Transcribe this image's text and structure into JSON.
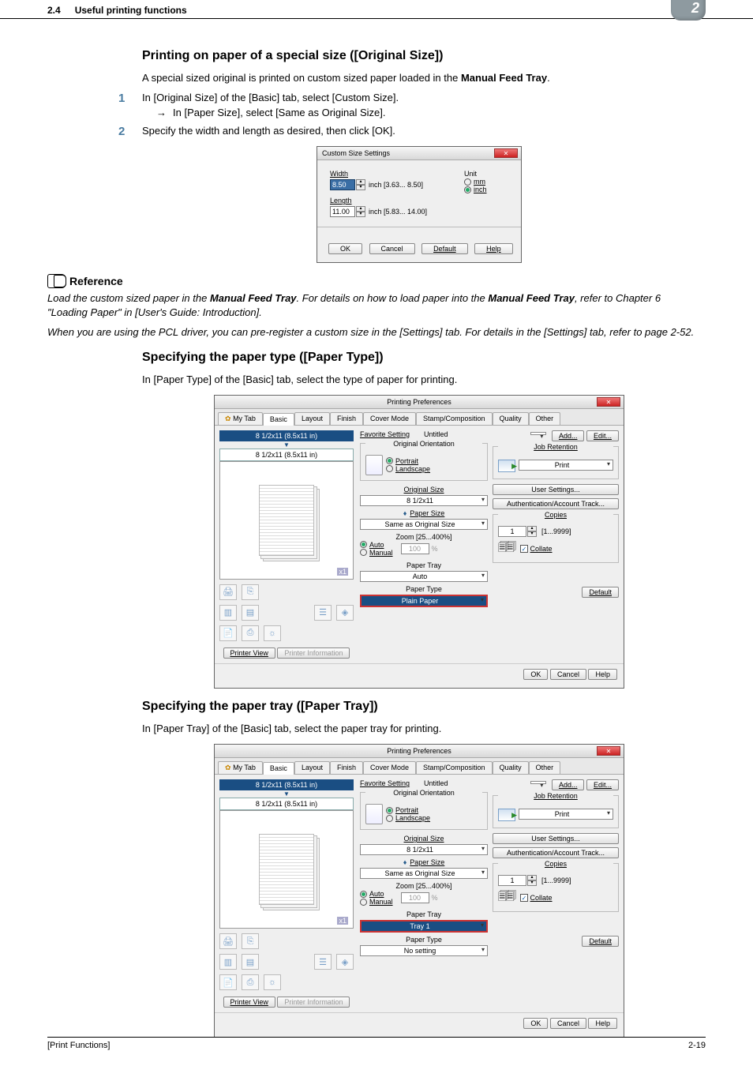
{
  "header": {
    "section_num": "2.4",
    "section_title": "Useful printing functions",
    "chapter": "2"
  },
  "section1": {
    "title": "Printing on paper of a special size ([Original Size])",
    "intro_a": "A special sized original is printed on custom sized paper loaded in the ",
    "intro_b": "Manual Feed Tray",
    "intro_c": ".",
    "step1": "In [Original Size] of the [Basic] tab, select [Custom Size].",
    "step1_sub": "In [Paper Size], select [Same as Original Size].",
    "step2": "Specify the width and length as desired, then click [OK]."
  },
  "custom_dialog": {
    "title": "Custom Size Settings",
    "width_label": "Width",
    "width_value": "8.50",
    "width_range": "inch [3.63... 8.50]",
    "length_label": "Length",
    "length_value": "11.00",
    "length_range": "inch [5.83... 14.00]",
    "unit_label": "Unit",
    "unit_mm": "mm",
    "unit_inch": "inch",
    "btn_ok": "OK",
    "btn_cancel": "Cancel",
    "btn_default": "Default",
    "btn_help": "Help"
  },
  "reference": {
    "heading": "Reference",
    "para1_a": "Load the custom sized paper in the ",
    "para1_b": "Manual Feed Tray",
    "para1_c": ". For details on how to load paper into the ",
    "para1_d": "Manual Feed Tray",
    "para1_e": ", refer to Chapter 6 \"Loading Paper\" in [User's Guide: Introduction].",
    "para2": "When you are using the PCL driver, you can pre-register a custom size in the [Settings] tab. For details in the [Settings] tab, refer to page 2-52."
  },
  "section2": {
    "title": "Specifying the paper type ([Paper Type])",
    "intro": "In [Paper Type] of the [Basic] tab, select the type of paper for printing."
  },
  "section3": {
    "title": "Specifying the paper tray ([Paper Tray])",
    "intro": "In [Paper Tray] of the [Basic] tab, select the paper tray for printing."
  },
  "pp": {
    "title": "Printing Preferences",
    "tabs": {
      "mytab": "My Tab",
      "basic": "Basic",
      "layout": "Layout",
      "finish": "Finish",
      "cover": "Cover Mode",
      "stamp": "Stamp/Composition",
      "quality": "Quality",
      "other": "Other"
    },
    "size_label": "8 1/2x11 (8.5x11 in)",
    "x1": "x1",
    "printer_view": "Printer View",
    "printer_info": "Printer Information",
    "favorite_label": "Favorite Setting",
    "favorite_value": "Untitled",
    "btn_add": "Add...",
    "btn_edit": "Edit...",
    "orientation_label": "Original Orientation",
    "portrait": "Portrait",
    "landscape": "Landscape",
    "original_size_label": "Original Size",
    "original_size_value": "8 1/2x11",
    "paper_size_label": "Paper Size",
    "paper_size_value": "Same as Original Size",
    "zoom_label": "Zoom [25...400%]",
    "zoom_auto": "Auto",
    "zoom_manual": "Manual",
    "zoom_value": "100",
    "zoom_pct": "%",
    "paper_tray_label": "Paper Tray",
    "paper_tray_auto": "Auto",
    "paper_tray_tray1": "Tray 1",
    "paper_type_label": "Paper Type",
    "paper_type_value": "Plain Paper",
    "paper_type_nosetting": "No setting",
    "job_label": "Job Retention",
    "job_value": "Print",
    "user_settings": "User Settings...",
    "auth": "Authentication/Account Track...",
    "copies_label": "Copies",
    "copies_value": "1",
    "copies_range": "[1...9999]",
    "collate": "Collate",
    "btn_default": "Default",
    "btn_ok": "OK",
    "btn_cancel": "Cancel",
    "btn_help": "Help"
  },
  "footer": {
    "left": "[Print Functions]",
    "right": "2-19"
  }
}
